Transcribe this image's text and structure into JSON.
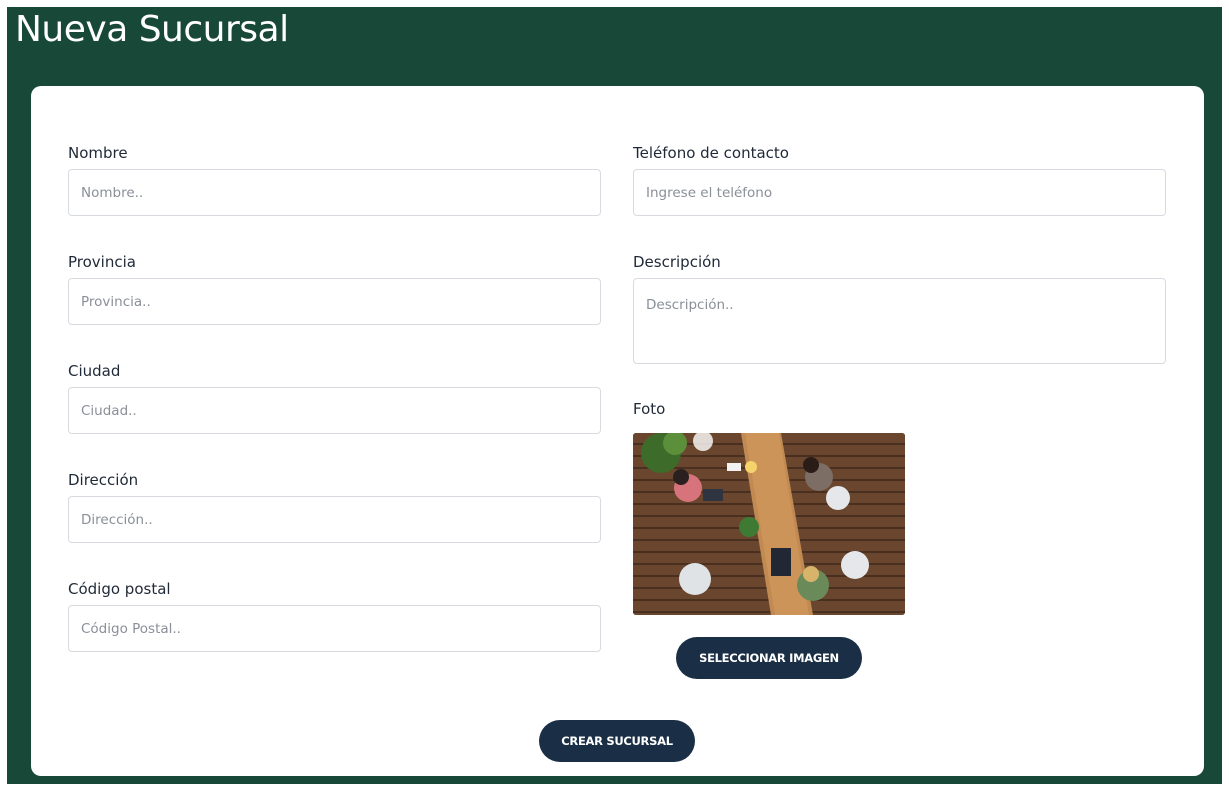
{
  "colors": {
    "background": "#184837",
    "button": "#1a2e45",
    "card": "#ffffff"
  },
  "page": {
    "title": "Nueva Sucursal"
  },
  "form": {
    "nombre": {
      "label": "Nombre",
      "placeholder": "Nombre.."
    },
    "provincia": {
      "label": "Provincia",
      "placeholder": "Provincia.."
    },
    "ciudad": {
      "label": "Ciudad",
      "placeholder": "Ciudad.."
    },
    "direccion": {
      "label": "Dirección",
      "placeholder": "Dirección.."
    },
    "codigo_postal": {
      "label": "Código postal",
      "placeholder": "Código Postal.."
    },
    "telefono": {
      "label": "Teléfono de contacto",
      "placeholder": "Ingrese el teléfono"
    },
    "descripcion": {
      "label": "Descripción",
      "placeholder": "Descripción.."
    },
    "foto": {
      "label": "Foto"
    }
  },
  "buttons": {
    "select_image": "SELECCIONAR IMAGEN",
    "create": "CREAR SUCURSAL"
  }
}
